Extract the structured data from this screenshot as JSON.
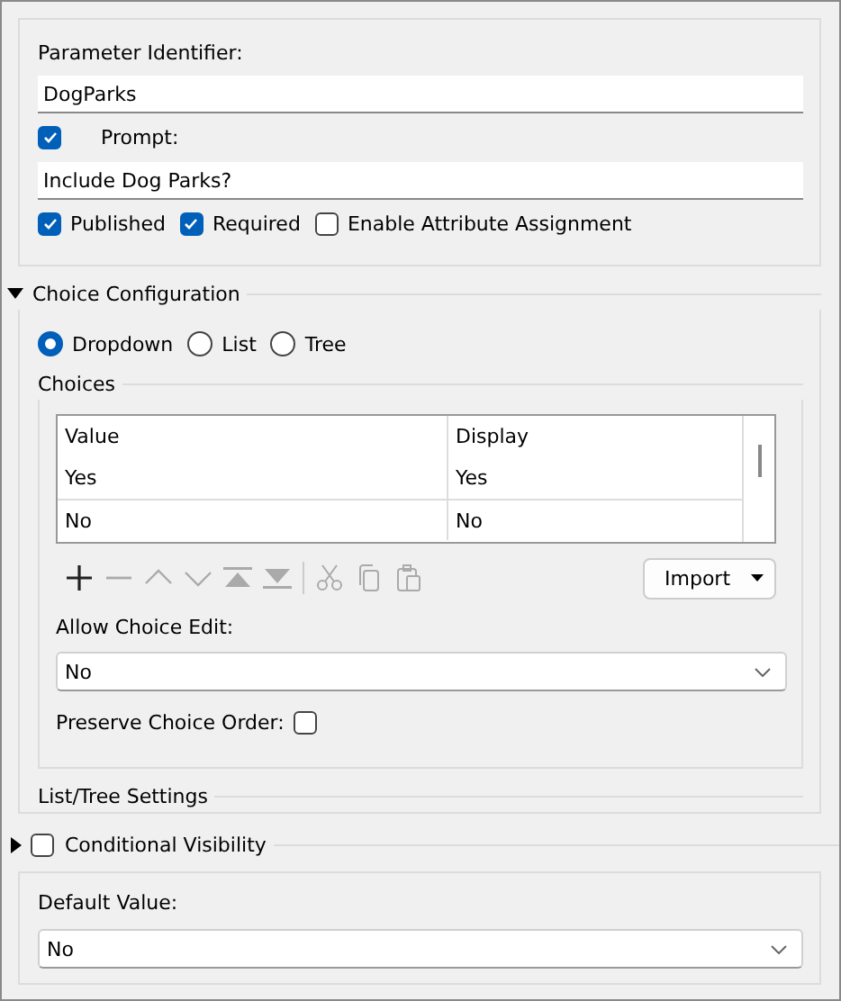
{
  "parameter_identifier": {
    "label": "Parameter Identifier:",
    "value": "DogParks"
  },
  "prompt": {
    "checked": true,
    "label": "Prompt:",
    "value": "Include Dog Parks?"
  },
  "flags": [
    {
      "label": "Published",
      "checked": true
    },
    {
      "label": "Required",
      "checked": true
    },
    {
      "label": "Enable Attribute Assignment",
      "checked": false
    }
  ],
  "choice_configuration": {
    "title": "Choice Configuration",
    "expanded": true,
    "modes": [
      {
        "label": "Dropdown",
        "selected": true
      },
      {
        "label": "List",
        "selected": false
      },
      {
        "label": "Tree",
        "selected": false
      }
    ],
    "choices": {
      "title": "Choices",
      "columns": [
        "Value",
        "Display"
      ],
      "rows": [
        [
          "Yes",
          "Yes"
        ],
        [
          "No",
          "No"
        ]
      ],
      "toolbar": [
        {
          "kind": "add",
          "disabled": false
        },
        {
          "kind": "remove",
          "disabled": true
        },
        {
          "kind": "up",
          "disabled": true
        },
        {
          "kind": "down",
          "disabled": true
        },
        {
          "kind": "top",
          "disabled": true
        },
        {
          "kind": "bottom",
          "disabled": true
        },
        {
          "kind": "separator"
        },
        {
          "kind": "cut",
          "disabled": true
        },
        {
          "kind": "copy",
          "disabled": true
        },
        {
          "kind": "paste",
          "disabled": true
        }
      ],
      "import_button": "Import"
    },
    "allow_choice_edit": {
      "label": "Allow Choice Edit:",
      "value": "No"
    },
    "preserve_choice_order": {
      "label": "Preserve Choice Order:",
      "checked": false
    },
    "list_tree_settings": {
      "title": "List/Tree Settings"
    }
  },
  "conditional_visibility": {
    "label": "Conditional Visibility",
    "checked": false,
    "expanded": false
  },
  "default_value": {
    "label": "Default Value:",
    "value": "No"
  }
}
